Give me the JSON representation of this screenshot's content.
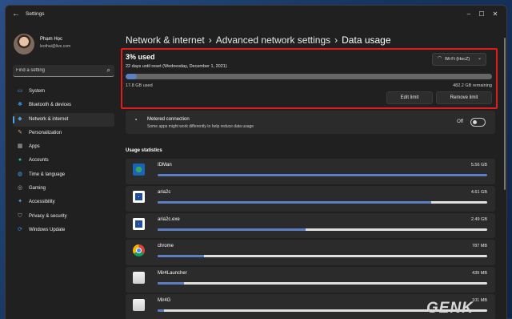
{
  "window": {
    "title": "Settings"
  },
  "user": {
    "name": "Phạm Học",
    "email": "leothai@live.com"
  },
  "search": {
    "placeholder": "Find a setting"
  },
  "sidebar": {
    "items": [
      {
        "label": "System",
        "icon": "system-icon",
        "color": "#5aa0e8"
      },
      {
        "label": "Bluetooth & devices",
        "icon": "bluetooth-icon",
        "color": "#3b8de0"
      },
      {
        "label": "Network & internet",
        "icon": "network-icon",
        "color": "#4c9be6",
        "active": true
      },
      {
        "label": "Personalization",
        "icon": "brush-icon",
        "color": "#e0a06a"
      },
      {
        "label": "Apps",
        "icon": "apps-icon",
        "color": "#b0b0b0"
      },
      {
        "label": "Accounts",
        "icon": "accounts-icon",
        "color": "#38b0a8"
      },
      {
        "label": "Time & language",
        "icon": "globe-icon",
        "color": "#4ca0e0"
      },
      {
        "label": "Gaming",
        "icon": "gaming-icon",
        "color": "#b0b0b0"
      },
      {
        "label": "Accessibility",
        "icon": "accessibility-icon",
        "color": "#5aa0e8"
      },
      {
        "label": "Privacy & security",
        "icon": "shield-icon",
        "color": "#9a9a9a"
      },
      {
        "label": "Windows Update",
        "icon": "update-icon",
        "color": "#3b8de0"
      }
    ]
  },
  "breadcrumb": [
    "Network & internet",
    "Advanced network settings",
    "Data usage"
  ],
  "usage": {
    "title": "3% used",
    "reset_text": "22 days until reset (Wednesday, December 1, 2021)",
    "network": "Wi-Fi (HocZ)",
    "used": "17.8 GB used",
    "remaining": "482.2 GB remaining",
    "fraction_used": 0.03,
    "edit_label": "Edit limit",
    "remove_label": "Remove limit"
  },
  "metered": {
    "title": "Metered connection",
    "description": "Some apps might work differently to help reduce data usage",
    "state": "Off"
  },
  "stats": {
    "heading": "Usage statistics",
    "apps": [
      {
        "name": "IDMan",
        "size": "5.56 GB",
        "fraction": 1.0,
        "icon": "idman-icon"
      },
      {
        "name": "aria2c",
        "size": "4.61 GB",
        "fraction": 0.83,
        "icon": "aria2c-icon"
      },
      {
        "name": "aria2c.exe",
        "size": "2.49 GB",
        "fraction": 0.45,
        "icon": "aria2c-exe-icon"
      },
      {
        "name": "chrome",
        "size": "787 MB",
        "fraction": 0.14,
        "icon": "chrome-icon"
      },
      {
        "name": "Mir4Launcher",
        "size": "439 MB",
        "fraction": 0.08,
        "icon": "mir4launcher-icon"
      },
      {
        "name": "Mir4G",
        "size": "101 MB",
        "fraction": 0.02,
        "icon": "mir4g-icon"
      }
    ]
  },
  "watermark": {
    "text": "GENK"
  },
  "colors": {
    "accent": "#4aa3f0",
    "bar_fill": "#5c7ec3",
    "highlight": "#e31b1b"
  }
}
